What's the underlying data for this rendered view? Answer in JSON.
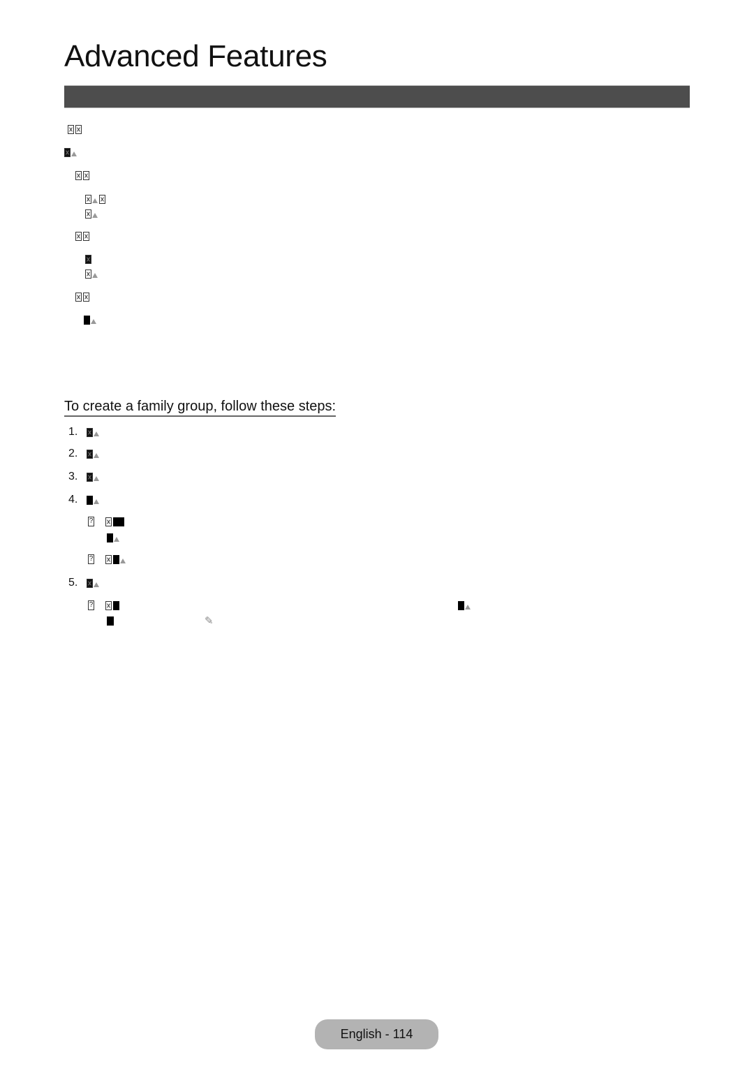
{
  "page": {
    "title": "Advanced Features",
    "section_bar_text": "",
    "subheading": "To create a family group, follow these steps:",
    "footer": {
      "language": "English",
      "separator": " - ",
      "page_number": "114",
      "label": "English - 114"
    }
  },
  "upper_block": {
    "note": "Text in this region is rendered as unrenderable glyph placeholders (missing-font boxes).",
    "lines": [
      {
        "indent_level": 0,
        "glyphs": "placeholder-pair"
      },
      {
        "indent_level": 0,
        "glyphs": "placeholder-with-note"
      },
      {
        "indent_level": 1,
        "glyphs": "placeholder-pair"
      },
      {
        "indent_level": 2,
        "glyphs": "placeholder-pair-with-note"
      },
      {
        "indent_level": 2,
        "glyphs": "placeholder-with-note"
      },
      {
        "indent_level": 1,
        "glyphs": "placeholder-pair"
      },
      {
        "indent_level": 2,
        "glyphs": "placeholder-single"
      },
      {
        "indent_level": 2,
        "glyphs": "placeholder-with-note"
      },
      {
        "indent_level": 1,
        "glyphs": "placeholder-pair"
      },
      {
        "indent_level": 2,
        "glyphs": "placeholder-with-note"
      }
    ]
  },
  "steps": [
    {
      "number": "1."
    },
    {
      "number": "2."
    },
    {
      "number": "3."
    },
    {
      "number": "4.",
      "sub_items": [
        {
          "marker": "?"
        },
        {
          "marker": "?"
        }
      ]
    },
    {
      "number": "5.",
      "sub_items": [
        {
          "marker": "?"
        }
      ]
    }
  ],
  "icons": {
    "pencil": "✎",
    "unknown_glyph": "?"
  },
  "colors": {
    "section_bar": "#4d4d4d",
    "footer_badge": "#b3b3b3",
    "text": "#111111"
  }
}
